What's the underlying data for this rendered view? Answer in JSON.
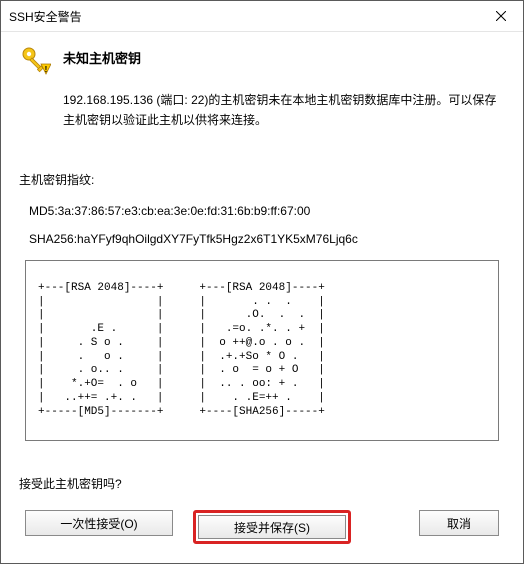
{
  "window": {
    "title": "SSH安全警告"
  },
  "content": {
    "heading": "未知主机密钥",
    "warning": "192.168.195.136 (端口: 22)的主机密钥未在本地主机密钥数据库中注册。可以保存主机密钥以验证此主机以供将来连接。",
    "fingerprint_label": "主机密钥指纹:",
    "fingerprint_md5": "MD5:3a:37:86:57:e3:cb:ea:3e:0e:fd:31:6b:b9:ff:67:00",
    "fingerprint_sha": "SHA256:haYFyf9qhOilgdXY7FyTfk5Hgz2x6T1YK5xM76Ljq6c",
    "randomart_rsa": "+---[RSA 2048]----+\n|                 |\n|                 |\n|       .E .      |\n|     . S o .     |\n|     .   o .     |\n|     . o.. .     |\n|    *.+O=  . o   |\n|   ..++= .+. .   |\n+-----[MD5]-------+",
    "randomart_sha": "+---[RSA 2048]----+\n|       . .  .    |\n|      .O.  .  .  |\n|   .=o. .*. . +  |\n|  o ++@.o . o .  |\n|  .+.+So * O .   |\n|  . o  = o + O   |\n|  .. . oo: + .   |\n|    . .E=++ .    |\n+----[SHA256]-----+",
    "prompt": "接受此主机密钥吗?"
  },
  "buttons": {
    "once": "一次性接受(O)",
    "accept_save": "接受并保存(S)",
    "cancel": "取消"
  }
}
